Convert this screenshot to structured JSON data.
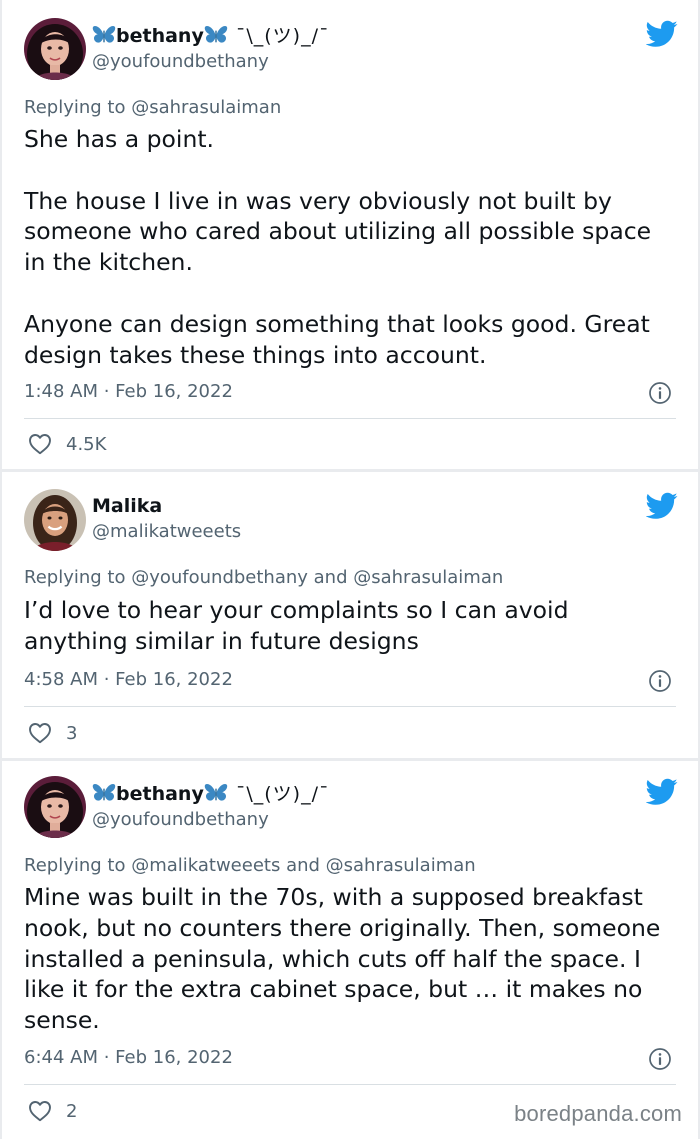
{
  "tweets": [
    {
      "name": "bethany",
      "decoration": "¯\\_(ツ)_/¯",
      "handle": "@youfoundbethany",
      "replying_to": "Replying to @sahrasulaiman",
      "paragraphs": [
        "She has a point.",
        "The house I live in was very obviously not built by someone who cared about utilizing all possible space in the kitchen.",
        "Anyone can design something that looks good. Great design takes these things into account."
      ],
      "timestamp": "1:48 AM · Feb 16, 2022",
      "likes": "4.5K",
      "avatar_icon": "woman-dark-hair-avatar",
      "platform_icon": "twitter-bird-icon"
    },
    {
      "name": "Malika",
      "decoration": "",
      "handle": "@malikatweeets",
      "replying_to": "Replying to @youfoundbethany and @sahrasulaiman",
      "paragraphs": [
        "I’d love to hear your complaints so I can avoid anything similar in future designs"
      ],
      "timestamp": "4:58 AM · Feb 16, 2022",
      "likes": "3",
      "avatar_icon": "woman-smiling-avatar",
      "platform_icon": "twitter-bird-icon"
    },
    {
      "name": "bethany",
      "decoration": "¯\\_(ツ)_/¯",
      "handle": "@youfoundbethany",
      "replying_to": "Replying to @malikatweeets and @sahrasulaiman",
      "paragraphs": [
        "Mine was built in the 70s, with a supposed breakfast nook, but no counters there originally. Then, someone installed a peninsula, which cuts off half the space. I like it for the extra cabinet space, but … it makes no sense."
      ],
      "timestamp": "6:44 AM · Feb 16, 2022",
      "likes": "2",
      "avatar_icon": "woman-dark-hair-avatar",
      "platform_icon": "twitter-bird-icon"
    }
  ],
  "watermark": "boredpanda.com",
  "colors": {
    "twitter_blue": "#1d9bf0",
    "butterfly_blue": "#3b88c3",
    "secondary_text": "#536471",
    "divider": "#d9dfe3",
    "background": "#e9ebee"
  }
}
